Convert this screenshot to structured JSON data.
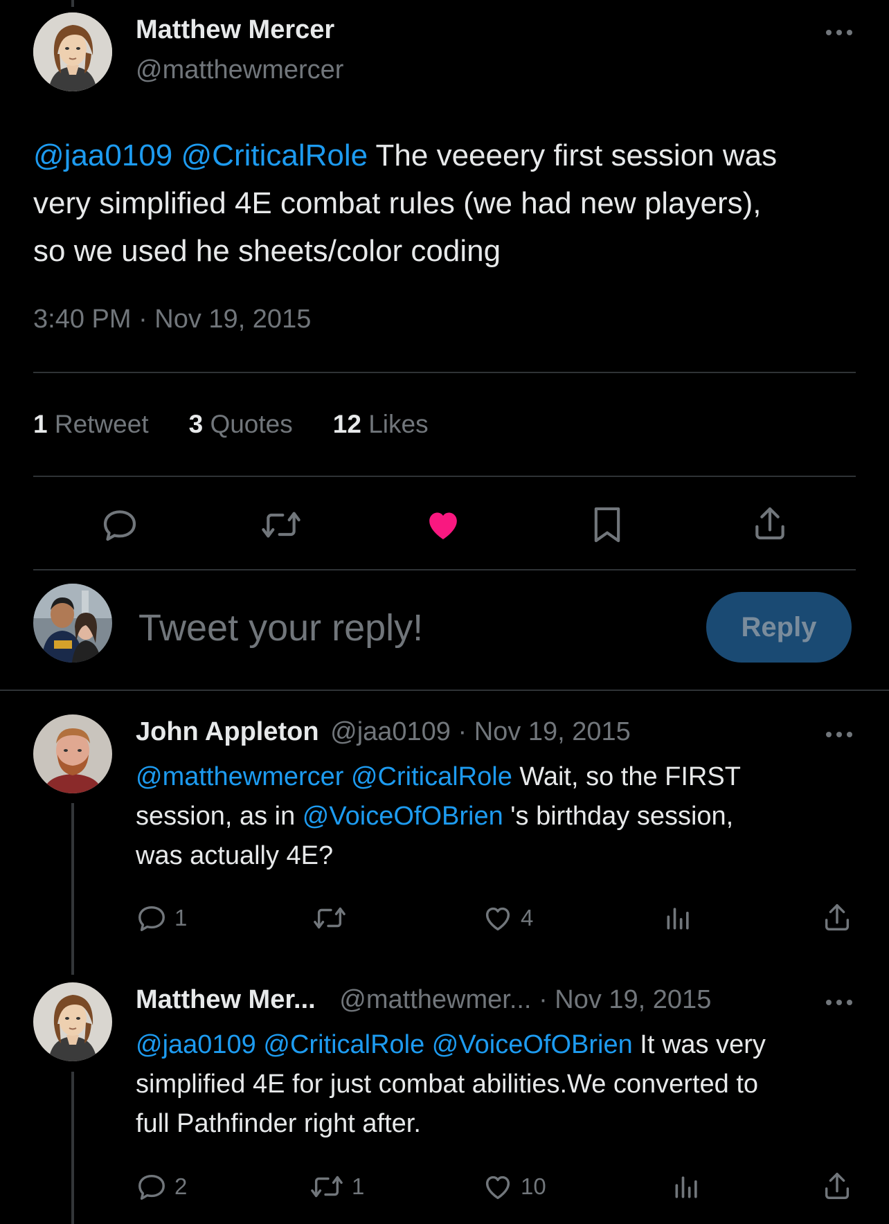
{
  "main_tweet": {
    "display_name": "Matthew Mercer",
    "handle": "@matthewmercer",
    "mention_1": "@jaa0109",
    "mention_2": "@CriticalRole",
    "text_line_1": " The veeeery first session was",
    "text_line_2": "very simplified 4E combat rules (we had new players),",
    "text_line_3": "so we used he sheets/color coding",
    "timestamp": "3:40 PM · Nov 19, 2015",
    "stats": {
      "retweets_count": "1",
      "retweets_label": "Retweet",
      "quotes_count": "3",
      "quotes_label": "Quotes",
      "likes_count": "12",
      "likes_label": "Likes"
    },
    "icons": [
      "reply-icon",
      "retweet-icon",
      "heart-filled-icon",
      "bookmark-icon",
      "share-icon"
    ]
  },
  "composer": {
    "placeholder": "Tweet your reply!",
    "reply_button": "Reply"
  },
  "replies": [
    {
      "display_name": "John Appleton",
      "handle": "@jaa0109",
      "date": "· Nov 19, 2015",
      "mention_1": "@matthewmercer",
      "mention_2": "@CriticalRole",
      "text_a": " Wait, so the FIRST",
      "text_b": "session, as in ",
      "mention_3": "@VoiceOfOBrien",
      "text_c": " 's birthday session,",
      "text_d": "was actually 4E?",
      "reply_count": "1",
      "retweet_count": "",
      "like_count": "4"
    },
    {
      "display_name": "Matthew Mer...",
      "handle": "@matthewmer...",
      "date": "· Nov 19, 2015",
      "mention_1": "@jaa0109",
      "mention_2": "@CriticalRole",
      "mention_3": "@VoiceOfOBrien",
      "text_a": " It was very",
      "text_b": "simplified 4E for just combat abilities.We converted to",
      "text_c": "full Pathfinder right after.",
      "reply_count": "2",
      "retweet_count": "1",
      "like_count": "10"
    }
  ],
  "colors": {
    "background": "#000000",
    "text": "#e7e9ea",
    "secondary": "#71767b",
    "link": "#1d9bf0",
    "like": "#f91880",
    "reply_button": "#1a4a73"
  }
}
